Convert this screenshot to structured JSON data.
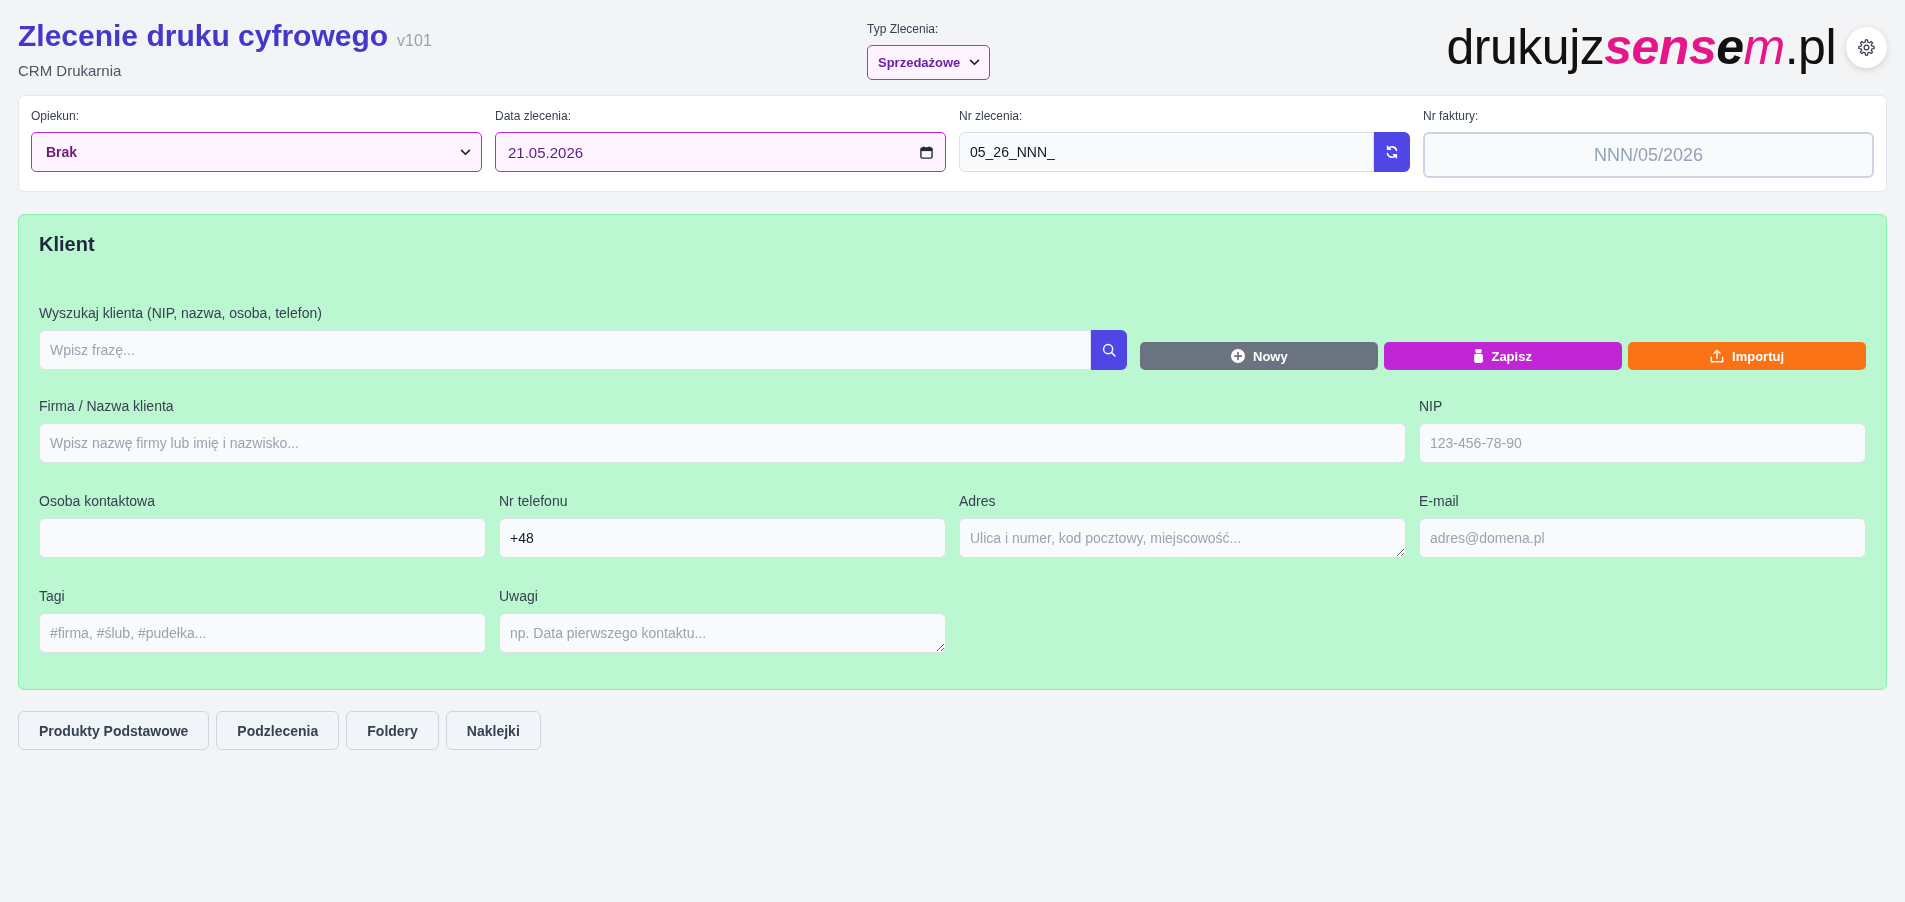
{
  "header": {
    "title": "Zlecenie druku cyfrowego",
    "version": "v101",
    "subtitle": "CRM Drukarnia"
  },
  "order_type": {
    "label": "Typ Zlecenia:",
    "value": "Sprzedażowe"
  },
  "logo": [
    {
      "text": "drukujz",
      "kind": "plain"
    },
    {
      "text": "sens",
      "kind": "strong"
    },
    {
      "text": "e",
      "kind": "dark"
    },
    {
      "text": "m",
      "kind": "light"
    },
    {
      "text": ".pl",
      "kind": "plain"
    }
  ],
  "order_fields": [
    {
      "kind": "select",
      "label": "Opiekun:",
      "value": "Brak"
    },
    {
      "kind": "date",
      "label": "Data zlecenia:",
      "value": "21.05.2026"
    },
    {
      "kind": "generated",
      "label": "Nr zlecenia:",
      "value": "05_26_NNN_"
    },
    {
      "kind": "invoice",
      "label": "Nr faktury:",
      "placeholder": "NNN/05/2026"
    }
  ],
  "client": {
    "title": "Klient",
    "search": {
      "label": "Wyszukaj klienta (NIP, nazwa, osoba, telefon)",
      "placeholder": "Wpisz frazę..."
    },
    "actions": [
      {
        "kind": "new",
        "label": "Nowy"
      },
      {
        "kind": "save",
        "label": "Zapisz"
      },
      {
        "kind": "import",
        "label": "Importuj"
      }
    ],
    "fields": [
      {
        "kind": "wide",
        "label": "Firma / Nazwa klienta",
        "placeholder": "Wpisz nazwę firmy lub imię i nazwisko..."
      },
      {
        "kind": "input",
        "label": "NIP",
        "placeholder": "123-456-78-90"
      },
      {
        "kind": "input",
        "label": "Osoba kontaktowa"
      },
      {
        "kind": "input",
        "label": "Nr telefonu",
        "value": "+48"
      },
      {
        "kind": "textarea",
        "label": "Adres",
        "placeholder": "Ulica i numer, kod pocztowy, miejscowość..."
      },
      {
        "kind": "input",
        "label": "E-mail",
        "placeholder": "adres@domena.pl"
      },
      {
        "kind": "input",
        "label": "Tagi",
        "placeholder": "#firma, #ślub, #pudełka..."
      },
      {
        "kind": "textarea",
        "label": "Uwagi",
        "placeholder": "np. Data pierwszego kontaktu..."
      }
    ]
  },
  "sections": [
    "Produkty Podstawowe",
    "Podzlecenia",
    "Foldery",
    "Naklejki"
  ]
}
